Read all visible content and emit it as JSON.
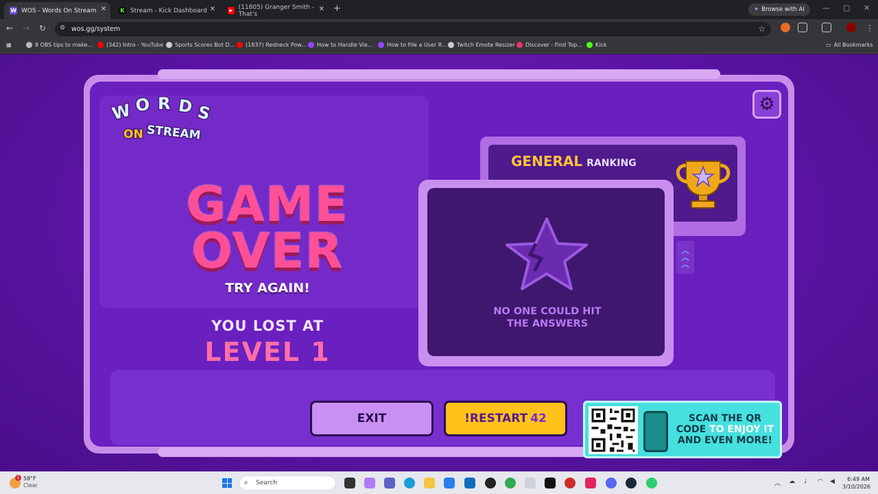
{
  "browser": {
    "tabs": [
      {
        "title": "WOS - Words On Stream",
        "fav_text": "W",
        "fav_color": "#6a4bd8",
        "active": true
      },
      {
        "title": "Stream - Kick Dashboard",
        "fav_text": "K",
        "fav_color": "#53fc18",
        "active": false
      },
      {
        "title": "(11805) Granger Smith - That's",
        "fav_text": "▶",
        "fav_color": "#ff0000",
        "active": false
      }
    ],
    "browse_ai": "Browse with AI",
    "url": "wos.gg/system",
    "bookmarks": [
      {
        "label": "8 OBS tips to make...",
        "color": "#bbbbbb"
      },
      {
        "label": "(342) Intro - YouTube",
        "color": "#ff0000"
      },
      {
        "label": "Sports Scores Bot D...",
        "color": "#cccccc"
      },
      {
        "label": "(1837) Redneck Pow...",
        "color": "#ff0000"
      },
      {
        "label": "How to Handle Vie...",
        "color": "#9147ff"
      },
      {
        "label": "How to File a User R...",
        "color": "#9147ff"
      },
      {
        "label": "Twitch Emote Resizer",
        "color": "#cccccc"
      },
      {
        "label": "Discover - Find Top...",
        "color": "#e8336b"
      },
      {
        "label": "Kick",
        "color": "#53fc18"
      }
    ],
    "all_bookmarks": "All Bookmarks"
  },
  "game": {
    "gear_icon": "gear-icon",
    "ranking": {
      "highlight": "GENERAL",
      "label": "RANKING"
    },
    "game_over_line1": "GAME",
    "game_over_line2": "OVER",
    "try_again": "TRY AGAIN!",
    "lost_at": "YOU LOST AT",
    "level": "LEVEL 1",
    "no_one_line1": "NO ONE COULD HIT",
    "no_one_line2": "THE ANSWERS",
    "exit_label": "EXIT",
    "restart_label": "!RESTART",
    "restart_count": "42",
    "qr": {
      "line1_dark": "SCAN THE QR",
      "line2_dark": "CODE",
      "line2_light": "TO ENJOY IT",
      "line3": "AND EVEN MORE!"
    },
    "colors": {
      "accent_pink": "#ff4f97",
      "gold": "#ffc21a",
      "purple_bg": "#5b14a3",
      "teal": "#46e0de"
    }
  },
  "taskbar": {
    "temp": "58°F",
    "weather": "Clear",
    "weather_badge": "1",
    "search_placeholder": "Search",
    "time": "6:49 AM",
    "date": "3/10/2026"
  }
}
